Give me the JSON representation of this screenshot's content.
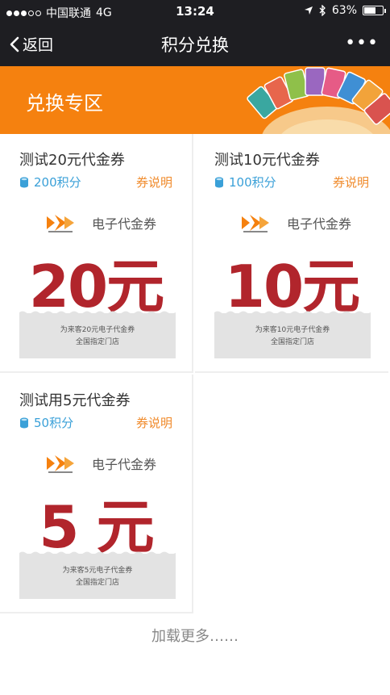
{
  "status_bar": {
    "carrier": "中国联通",
    "network": "4G",
    "time": "13:24",
    "battery": "63%",
    "battery_level": 0.63
  },
  "nav": {
    "back_label": "返回",
    "title": "积分兑换",
    "more_label": "•••"
  },
  "banner": {
    "title": "兑换专区"
  },
  "coupons": [
    {
      "name": "测试20元代金券",
      "points": "200积分",
      "explain": "券说明",
      "voucher_type": "电子代金券",
      "amount": "20元",
      "desc_line1": "为来客20元电子代金券",
      "desc_line2": "全国指定门店"
    },
    {
      "name": "测试10元代金券",
      "points": "100积分",
      "explain": "券说明",
      "voucher_type": "电子代金券",
      "amount": "10元",
      "desc_line1": "为来客10元电子代金券",
      "desc_line2": "全国指定门店"
    },
    {
      "name": "测试用5元代金券",
      "points": "50积分",
      "explain": "券说明",
      "voucher_type": "电子代金券",
      "amount": "5 元",
      "desc_line1": "为来客5元电子代金券",
      "desc_line2": "全国指定门店"
    }
  ],
  "load_more": "加载更多……",
  "colors": {
    "accent_orange": "#f5810f",
    "amount_red": "#b1252c",
    "points_blue": "#3aa0d8",
    "link_orange": "#f08a2a"
  },
  "icons": [
    "signal-icon",
    "location-icon",
    "bluetooth-icon",
    "battery-icon",
    "back-chevron-icon",
    "more-icon",
    "coin-icon",
    "brand-logo"
  ]
}
